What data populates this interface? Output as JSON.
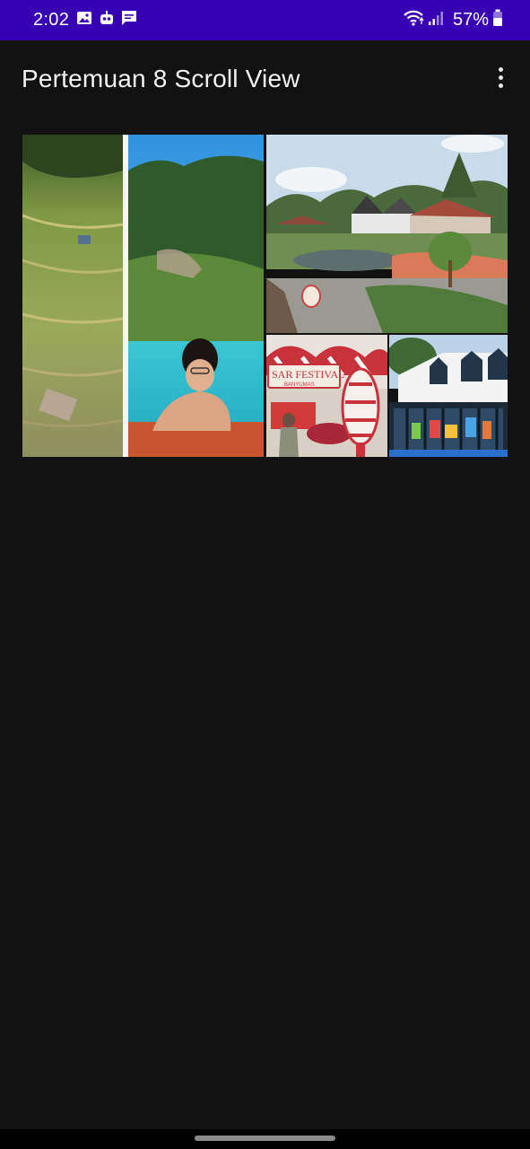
{
  "status_bar": {
    "time": "2:02",
    "left_icons": [
      "gallery-icon",
      "robot-icon",
      "message-icon"
    ],
    "right_icons": [
      "wifi-icon",
      "signal-icon"
    ],
    "battery_percent": "57%",
    "battery_level": 0.57,
    "background": "#3700b3"
  },
  "app_bar": {
    "title": "Pertemuan 8 Scroll View",
    "overflow_icon": "more-vert-icon"
  },
  "content": {
    "images": [
      {
        "name": "rice-terrace-pool-photo"
      },
      {
        "name": "park-pond-photo"
      },
      {
        "name": "festival-photo",
        "sign_text": "SAR FESTIVAL",
        "sign_subtext": "BANYUMAS"
      },
      {
        "name": "white-building-photo"
      }
    ]
  }
}
